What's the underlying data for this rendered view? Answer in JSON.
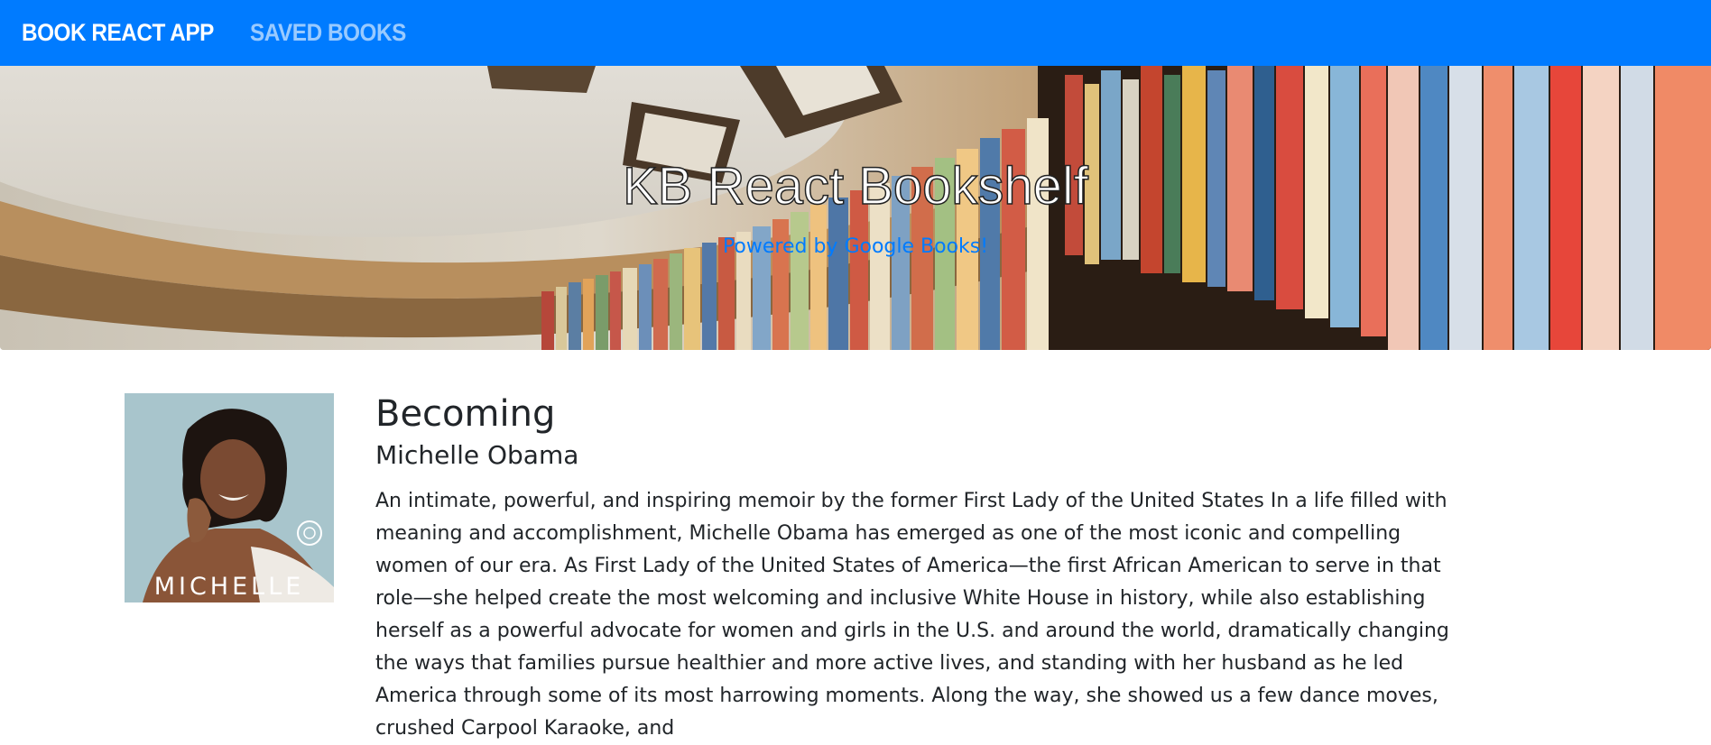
{
  "navbar": {
    "brand": "BOOK REACT APP",
    "saved_link": "SAVED BOOKS",
    "background": "#007bff"
  },
  "hero": {
    "title": "KB React Bookshelf",
    "subtitle": "Powered by Google Books!",
    "subtitle_color": "#007bff",
    "background_description_icon": "bookshelf-photo"
  },
  "book": {
    "title": "Becoming",
    "author": "Michelle Obama",
    "cover_text": "MICHELLE",
    "description": "An intimate, powerful, and inspiring memoir by the former First Lady of the United States In a life filled with meaning and accomplishment, Michelle Obama has emerged as one of the most iconic and compelling women of our era. As First Lady of the United States of America—the first African American to serve in that role—she helped create the most welcoming and inclusive White House in history, while also establishing herself as a powerful advocate for women and girls in the U.S. and around the world, dramatically changing the ways that families pursue healthier and more active lives, and standing with her husband as he led America through some of its most harrowing moments. Along the way, she showed us a few dance moves, crushed Carpool Karaoke, and"
  }
}
